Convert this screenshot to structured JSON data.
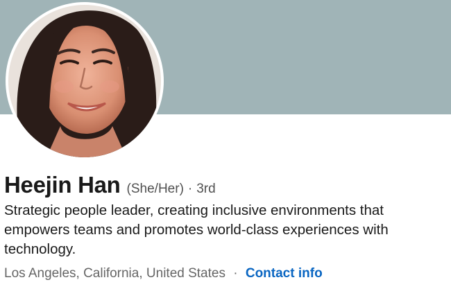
{
  "profile": {
    "name": "Heejin Han",
    "pronouns": "(She/Her)",
    "separator": "·",
    "connection_degree": "3rd",
    "headline": "Strategic people leader, creating inclusive environments that empowers teams and promotes world-class experiences with technology.",
    "location": "Los Angeles, California, United States",
    "contact_info_label": "Contact info"
  },
  "colors": {
    "banner": "#a0b4b7",
    "link": "#0a66c2",
    "name_text": "#191919",
    "muted_text": "#666666"
  },
  "icons": {
    "avatar": "profile-photo"
  }
}
